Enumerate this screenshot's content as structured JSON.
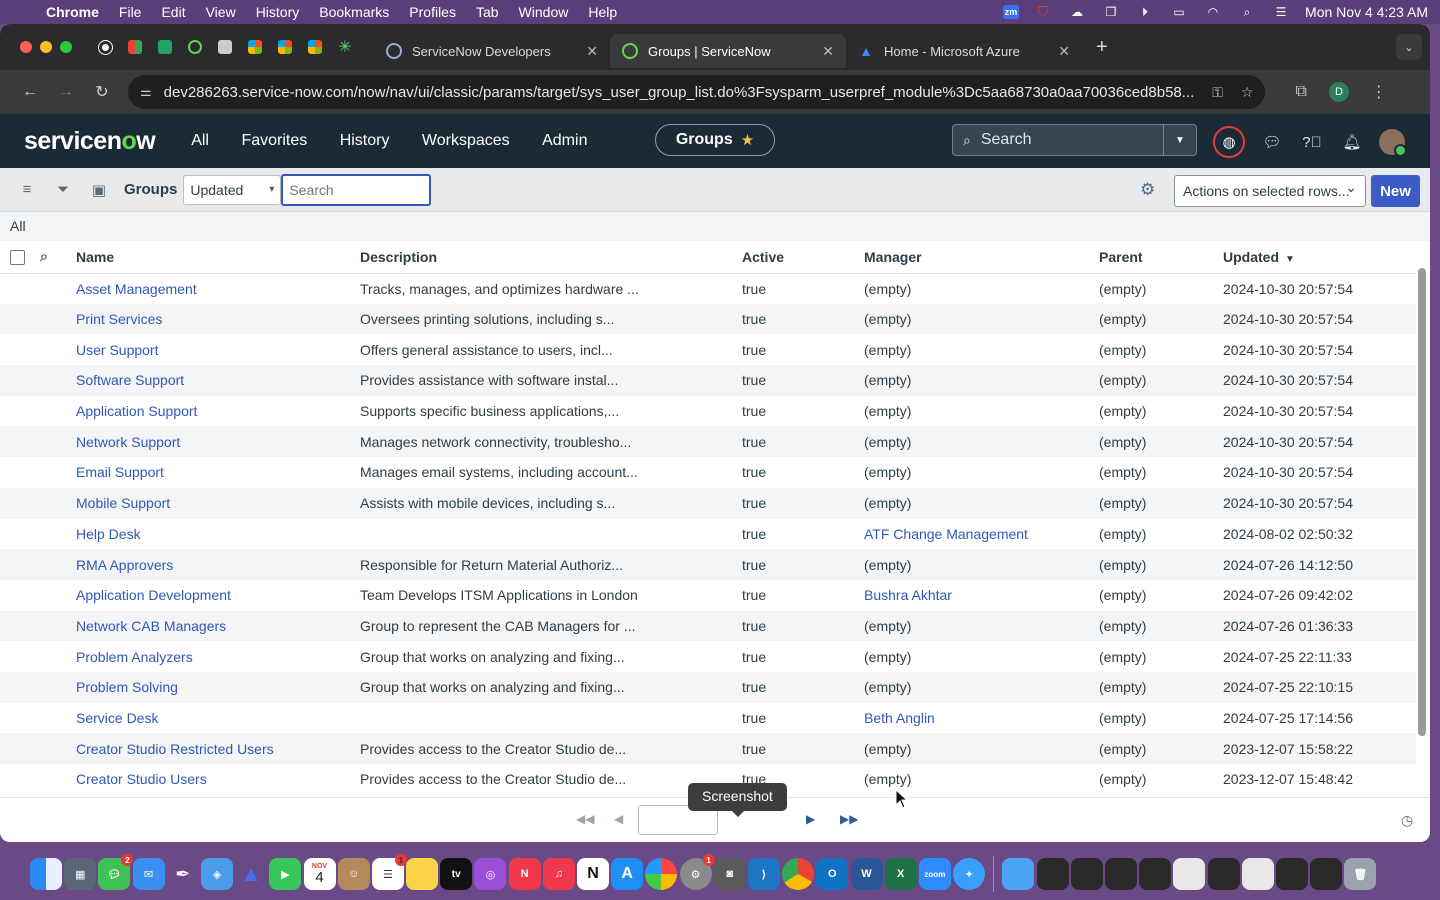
{
  "menubar": {
    "app": "Chrome",
    "items": [
      "File",
      "Edit",
      "View",
      "History",
      "Bookmarks",
      "Profiles",
      "Tab",
      "Window",
      "Help"
    ],
    "clock": "Mon Nov 4  4:23 AM",
    "zoom_badge": "zm"
  },
  "browser": {
    "tabs": [
      {
        "title": "ServiceNow Developers",
        "active": false
      },
      {
        "title": "Groups | ServiceNow",
        "active": true
      },
      {
        "title": "Home - Microsoft Azure",
        "active": false
      }
    ],
    "url": "dev286263.service-now.com/now/nav/ui/classic/params/target/sys_user_group_list.do%3Fsysparm_userpref_module%3Dc5aa68730a0aa70036ced8b58...",
    "profile_initial": "D"
  },
  "snheader": {
    "logo_prefix": "servicen",
    "logo_o": "o",
    "logo_suffix": "w",
    "nav": [
      "All",
      "Favorites",
      "History",
      "Workspaces",
      "Admin"
    ],
    "context_pill": "Groups",
    "search_placeholder": "Search"
  },
  "listbar": {
    "title": "Groups",
    "field_select": "Updated",
    "search_placeholder": "Search",
    "actions_label": "Actions on selected rows...",
    "new_label": "New",
    "breadcrumb": "All"
  },
  "table": {
    "columns": [
      "Name",
      "Description",
      "Active",
      "Manager",
      "Parent",
      "Updated"
    ],
    "rows": [
      {
        "name": "Asset Management",
        "description": "Tracks, manages, and optimizes hardware ...",
        "active": "true",
        "manager": "(empty)",
        "manager_link": false,
        "parent": "(empty)",
        "updated": "2024-10-30 20:57:54"
      },
      {
        "name": "Print Services",
        "description": "Oversees printing solutions, including s...",
        "active": "true",
        "manager": "(empty)",
        "manager_link": false,
        "parent": "(empty)",
        "updated": "2024-10-30 20:57:54"
      },
      {
        "name": "User Support",
        "description": "Offers general assistance to users, incl...",
        "active": "true",
        "manager": "(empty)",
        "manager_link": false,
        "parent": "(empty)",
        "updated": "2024-10-30 20:57:54"
      },
      {
        "name": "Software Support",
        "description": "Provides assistance with software instal...",
        "active": "true",
        "manager": "(empty)",
        "manager_link": false,
        "parent": "(empty)",
        "updated": "2024-10-30 20:57:54"
      },
      {
        "name": "Application Support",
        "description": "Supports specific business applications,...",
        "active": "true",
        "manager": "(empty)",
        "manager_link": false,
        "parent": "(empty)",
        "updated": "2024-10-30 20:57:54"
      },
      {
        "name": "Network Support",
        "description": "Manages network connectivity, troublesho...",
        "active": "true",
        "manager": "(empty)",
        "manager_link": false,
        "parent": "(empty)",
        "updated": "2024-10-30 20:57:54"
      },
      {
        "name": "Email Support",
        "description": "Manages email systems, including account...",
        "active": "true",
        "manager": "(empty)",
        "manager_link": false,
        "parent": "(empty)",
        "updated": "2024-10-30 20:57:54"
      },
      {
        "name": "Mobile Support",
        "description": "Assists with mobile devices, including s...",
        "active": "true",
        "manager": "(empty)",
        "manager_link": false,
        "parent": "(empty)",
        "updated": "2024-10-30 20:57:54"
      },
      {
        "name": "Help Desk",
        "description": "",
        "active": "true",
        "manager": "ATF Change Management",
        "manager_link": true,
        "parent": "(empty)",
        "updated": "2024-08-02 02:50:32"
      },
      {
        "name": "RMA Approvers",
        "description": "Responsible for Return Material Authoriz...",
        "active": "true",
        "manager": "(empty)",
        "manager_link": false,
        "parent": "(empty)",
        "updated": "2024-07-26 14:12:50"
      },
      {
        "name": "Application Development",
        "description": "Team Develops ITSM Applications in London",
        "active": "true",
        "manager": "Bushra Akhtar",
        "manager_link": true,
        "parent": "(empty)",
        "updated": "2024-07-26 09:42:02"
      },
      {
        "name": "Network CAB Managers",
        "description": "Group to represent the CAB Managers for ...",
        "active": "true",
        "manager": "(empty)",
        "manager_link": false,
        "parent": "(empty)",
        "updated": "2024-07-26 01:36:33"
      },
      {
        "name": "Problem Analyzers",
        "description": "Group that works on analyzing and fixing...",
        "active": "true",
        "manager": "(empty)",
        "manager_link": false,
        "parent": "(empty)",
        "updated": "2024-07-25 22:11:33"
      },
      {
        "name": "Problem Solving",
        "description": "Group that works on analyzing and fixing...",
        "active": "true",
        "manager": "(empty)",
        "manager_link": false,
        "parent": "(empty)",
        "updated": "2024-07-25 22:10:15"
      },
      {
        "name": "Service Desk",
        "description": "",
        "active": "true",
        "manager": "Beth Anglin",
        "manager_link": true,
        "parent": "(empty)",
        "updated": "2024-07-25 17:14:56"
      },
      {
        "name": "Creator Studio Restricted Users",
        "description": "Provides access to the Creator Studio de...",
        "active": "true",
        "manager": "(empty)",
        "manager_link": false,
        "parent": "(empty)",
        "updated": "2023-12-07 15:58:22"
      },
      {
        "name": "Creator Studio Users",
        "description": "Provides access to the Creator Studio de...",
        "active": "true",
        "manager": "(empty)",
        "manager_link": false,
        "parent": "(empty)",
        "updated": "2023-12-07 15:48:42"
      }
    ]
  },
  "pager": {
    "tooltip": "Screenshot"
  },
  "dock": {
    "calendar_month": "NOV",
    "calendar_day": "4",
    "zoom_label": "zoom",
    "tv_label": "tv",
    "notion_label": "N",
    "messages_badge": "2",
    "reminders_badge": "1",
    "settings_badge": "1"
  },
  "colors": {
    "link": "#3058b7",
    "header_bg": "#1a2b36",
    "new_button": "#3b5cc4",
    "logo_accent": "#62d84e"
  }
}
